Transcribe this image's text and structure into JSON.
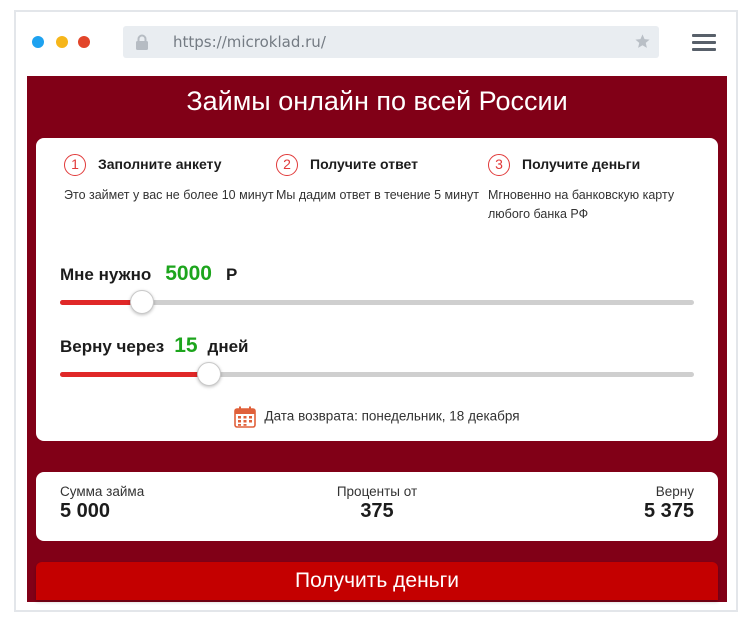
{
  "browser": {
    "url": "https://microklad.ru/"
  },
  "page": {
    "title": "Займы онлайн по всей России"
  },
  "steps": [
    {
      "num": "1",
      "title": "Заполните анкету",
      "desc": "Это займет у вас не более 10 минут"
    },
    {
      "num": "2",
      "title": "Получите ответ",
      "desc": "Мы дадим ответ в течение 5 минут"
    },
    {
      "num": "3",
      "title": "Получите деньги",
      "desc": "Мгновенно на банковскую карту любого банка РФ"
    }
  ],
  "amount": {
    "label": "Мне нужно",
    "value": "5000",
    "unit": "Р",
    "fraction": 0.13
  },
  "term": {
    "label": "Верну через",
    "value": "15",
    "unit": "дней",
    "fraction": 0.235
  },
  "return_date": "Дата возврата: понедельник, 18 декабря",
  "summary": {
    "loan_label": "Сумма займа",
    "loan_value": "5 000",
    "interest_label": "Проценты от",
    "interest_value": "375",
    "repay_label": "Верну",
    "repay_value": "5 375"
  },
  "cta_label": "Получить деньги",
  "colors": {
    "brand": "#810017",
    "accent": "#e02828",
    "value_green": "#1da51d",
    "button": "#c40000"
  }
}
